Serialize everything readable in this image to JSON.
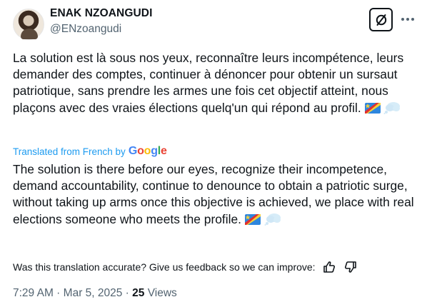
{
  "author": {
    "name": "ENAK NZOANGUDI",
    "handle": "@ENzoangudi"
  },
  "tweet": {
    "text": "La solution est là sous nos yeux, reconnaître leurs incompétence, leurs demander des comptes, continuer à dénoncer pour obtenir un sursaut patriotique, sans prendre les armes une fois cet objectif atteint, nous plaçons avec des vraies élections quelq'un qui répond au profil.",
    "emojis": [
      "flag-drc-icon",
      "thought-bubble-icon"
    ]
  },
  "translation": {
    "label": "Translated from French by",
    "provider": "Google",
    "text": "The solution is there before our eyes, recognize their incompetence, demand accountability, continue to denounce to obtain a patriotic surge, without taking up arms once this objective is achieved, we place with real elections someone who meets the profile."
  },
  "feedback": {
    "question": "Was this translation accurate? Give us feedback so we can improve:"
  },
  "meta": {
    "time": "7:29 AM",
    "separator": " · ",
    "date": "Mar 5, 2025",
    "views_count": "25",
    "views_label": "Views"
  },
  "colors": {
    "link_blue": "#1d9bf0",
    "secondary_text": "#536471",
    "primary_text": "#0f1419"
  }
}
